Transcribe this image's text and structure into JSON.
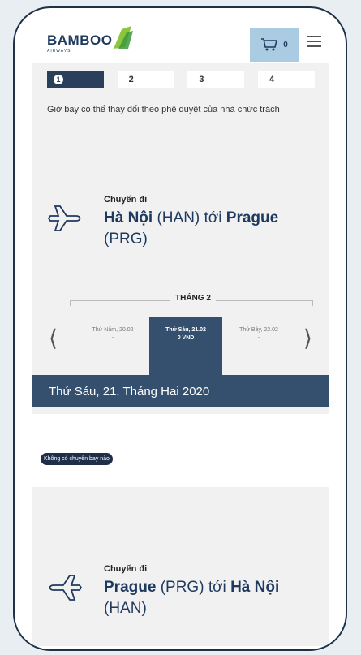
{
  "header": {
    "logo_text": "BAMBOO",
    "logo_sub": "AIRWAYS",
    "cart_count": "0"
  },
  "steps": [
    "1",
    "2",
    "3",
    "4"
  ],
  "notice": "Giờ bay có thể thay đổi theo phê duyệt của nhà chức trách",
  "outbound": {
    "label": "Chuyến đi",
    "origin_city": "Hà Nội",
    "origin_code": "(HAN)",
    "connector": "tới",
    "dest_city": "Prague",
    "dest_code": "(PRG)"
  },
  "month": "THÁNG 2",
  "days": [
    {
      "label": "Thứ Năm, 20.02",
      "price": "-"
    },
    {
      "label": "Thứ Sáu, 21.02",
      "price": "0 VND"
    },
    {
      "label": "Thứ Bảy, 22.02",
      "price": "-"
    }
  ],
  "selected_date": "Thứ Sáu, 21. Tháng Hai 2020",
  "no_flight_badge": "Không có chuyến bay nào",
  "return": {
    "label": "Chuyến đi",
    "origin_city": "Prague",
    "origin_code": "(PRG)",
    "connector": "tới",
    "dest_city": "Hà Nội",
    "dest_code": "(HAN)"
  },
  "colors": {
    "navy": "#2a3f5a",
    "banner": "#35506e",
    "cart_bg": "#a9cce3",
    "leaf_green": "#8cc63f"
  }
}
